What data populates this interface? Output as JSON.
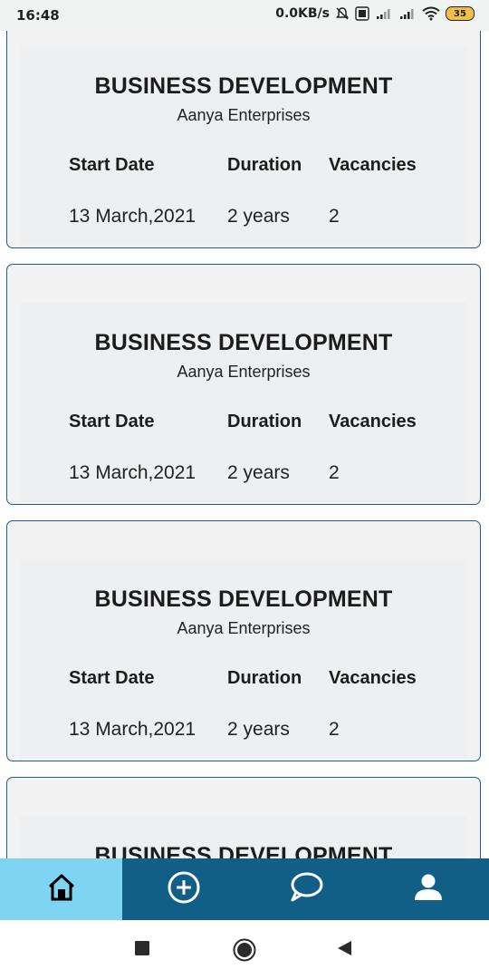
{
  "status_bar": {
    "time": "16:48",
    "network_speed": "0.0KB/s",
    "battery_level": "35",
    "icons": [
      "alarm-off-icon",
      "volte-icon",
      "signal-icon",
      "signal-icon",
      "wifi-icon",
      "battery-icon"
    ]
  },
  "cards": [
    {
      "title": "BUSINESS DEVELOPMENT",
      "company": "Aanya Enterprises",
      "labels": {
        "start": "Start Date",
        "duration": "Duration",
        "vacancies": "Vacancies"
      },
      "values": {
        "start": "13 March,2021",
        "duration": "2 years",
        "vacancies": "2"
      }
    },
    {
      "title": "BUSINESS DEVELOPMENT",
      "company": "Aanya Enterprises",
      "labels": {
        "start": "Start Date",
        "duration": "Duration",
        "vacancies": "Vacancies"
      },
      "values": {
        "start": "13 March,2021",
        "duration": "2 years",
        "vacancies": "2"
      }
    },
    {
      "title": "BUSINESS DEVELOPMENT",
      "company": "Aanya Enterprises",
      "labels": {
        "start": "Start Date",
        "duration": "Duration",
        "vacancies": "Vacancies"
      },
      "values": {
        "start": "13 March,2021",
        "duration": "2 years",
        "vacancies": "2"
      }
    },
    {
      "title": "BUSINESS DEVELOPMENT",
      "company": "",
      "labels": {
        "start": "",
        "duration": "",
        "vacancies": ""
      },
      "values": {
        "start": "",
        "duration": "",
        "vacancies": ""
      }
    }
  ],
  "bottom_nav": {
    "items": [
      {
        "icon": "home-icon",
        "active": true
      },
      {
        "icon": "add-circle-icon",
        "active": false
      },
      {
        "icon": "chat-bubble-icon",
        "active": false
      },
      {
        "icon": "profile-icon",
        "active": false
      }
    ],
    "colors": {
      "bar": "#115e86",
      "active": "#7fd4f2"
    }
  },
  "system_nav": {
    "icons": [
      "recents-square-icon",
      "home-circle-icon",
      "back-triangle-icon"
    ]
  },
  "colors": {
    "card_border": "#1f5d86",
    "card_bg": "#f2f2f2"
  }
}
